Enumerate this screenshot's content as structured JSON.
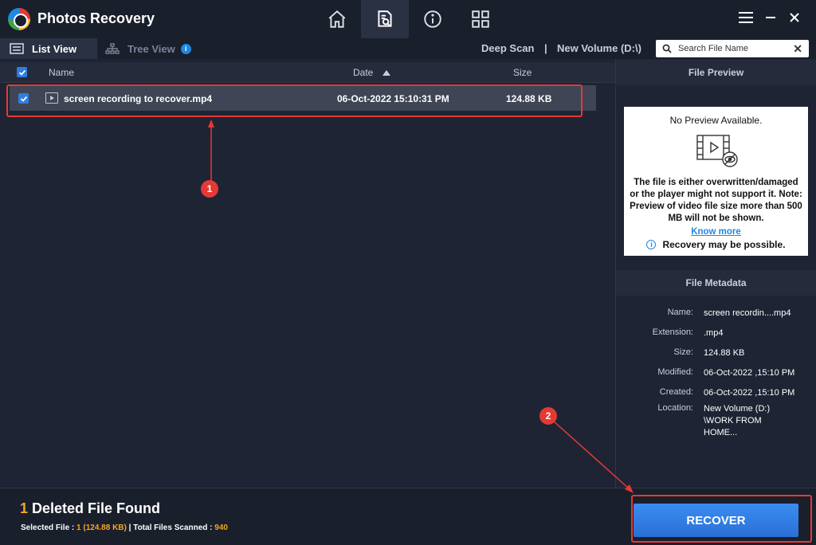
{
  "app": {
    "title": "Photos Recovery"
  },
  "views": {
    "list": "List View",
    "tree": "Tree View",
    "tree_badge": "i"
  },
  "scan": {
    "type": "Deep Scan",
    "separator": "|",
    "volume": "New Volume (D:\\)"
  },
  "search": {
    "placeholder": "Search File Name",
    "clear": "✕"
  },
  "table": {
    "columns": {
      "name": "Name",
      "date": "Date",
      "size": "Size"
    },
    "rows": [
      {
        "name": "screen recording to recover.mp4",
        "date": "06-Oct-2022 15:10:31 PM",
        "size": "124.88 KB",
        "checked": true
      }
    ]
  },
  "preview": {
    "heading": "File Preview",
    "title": "No Preview Available.",
    "message": "The file is either overwritten/damaged or the player might not support it. Note: Preview of video file size more than 500 MB will not be shown.",
    "link": "Know more",
    "note": "Recovery may be possible."
  },
  "metadata": {
    "heading": "File Metadata",
    "name_label": "Name:",
    "name": "screen recordin....mp4",
    "ext_label": "Extension:",
    "ext": ".mp4",
    "size_label": "Size:",
    "size": "124.88 KB",
    "modified_label": "Modified:",
    "modified": "06-Oct-2022 ,15:10 PM",
    "created_label": "Created:",
    "created": "06-Oct-2022 ,15:10 PM",
    "location_label": "Location:",
    "location_l1": "New Volume (D:)",
    "location_l2": "\\WORK FROM",
    "location_l3": "HOME..."
  },
  "footer": {
    "count": "1",
    "found_text": " Deleted File Found",
    "selected_label": "Selected File : ",
    "selected_value": "1 (124.88 KB)",
    "total_label": " | Total Files Scanned : ",
    "total_value": "940"
  },
  "recover_label": "RECOVER",
  "annotations": {
    "marker1": "1",
    "marker2": "2"
  },
  "colors": {
    "accent": "#2f7de1",
    "highlight": "#e53935",
    "count": "#f5a623"
  }
}
